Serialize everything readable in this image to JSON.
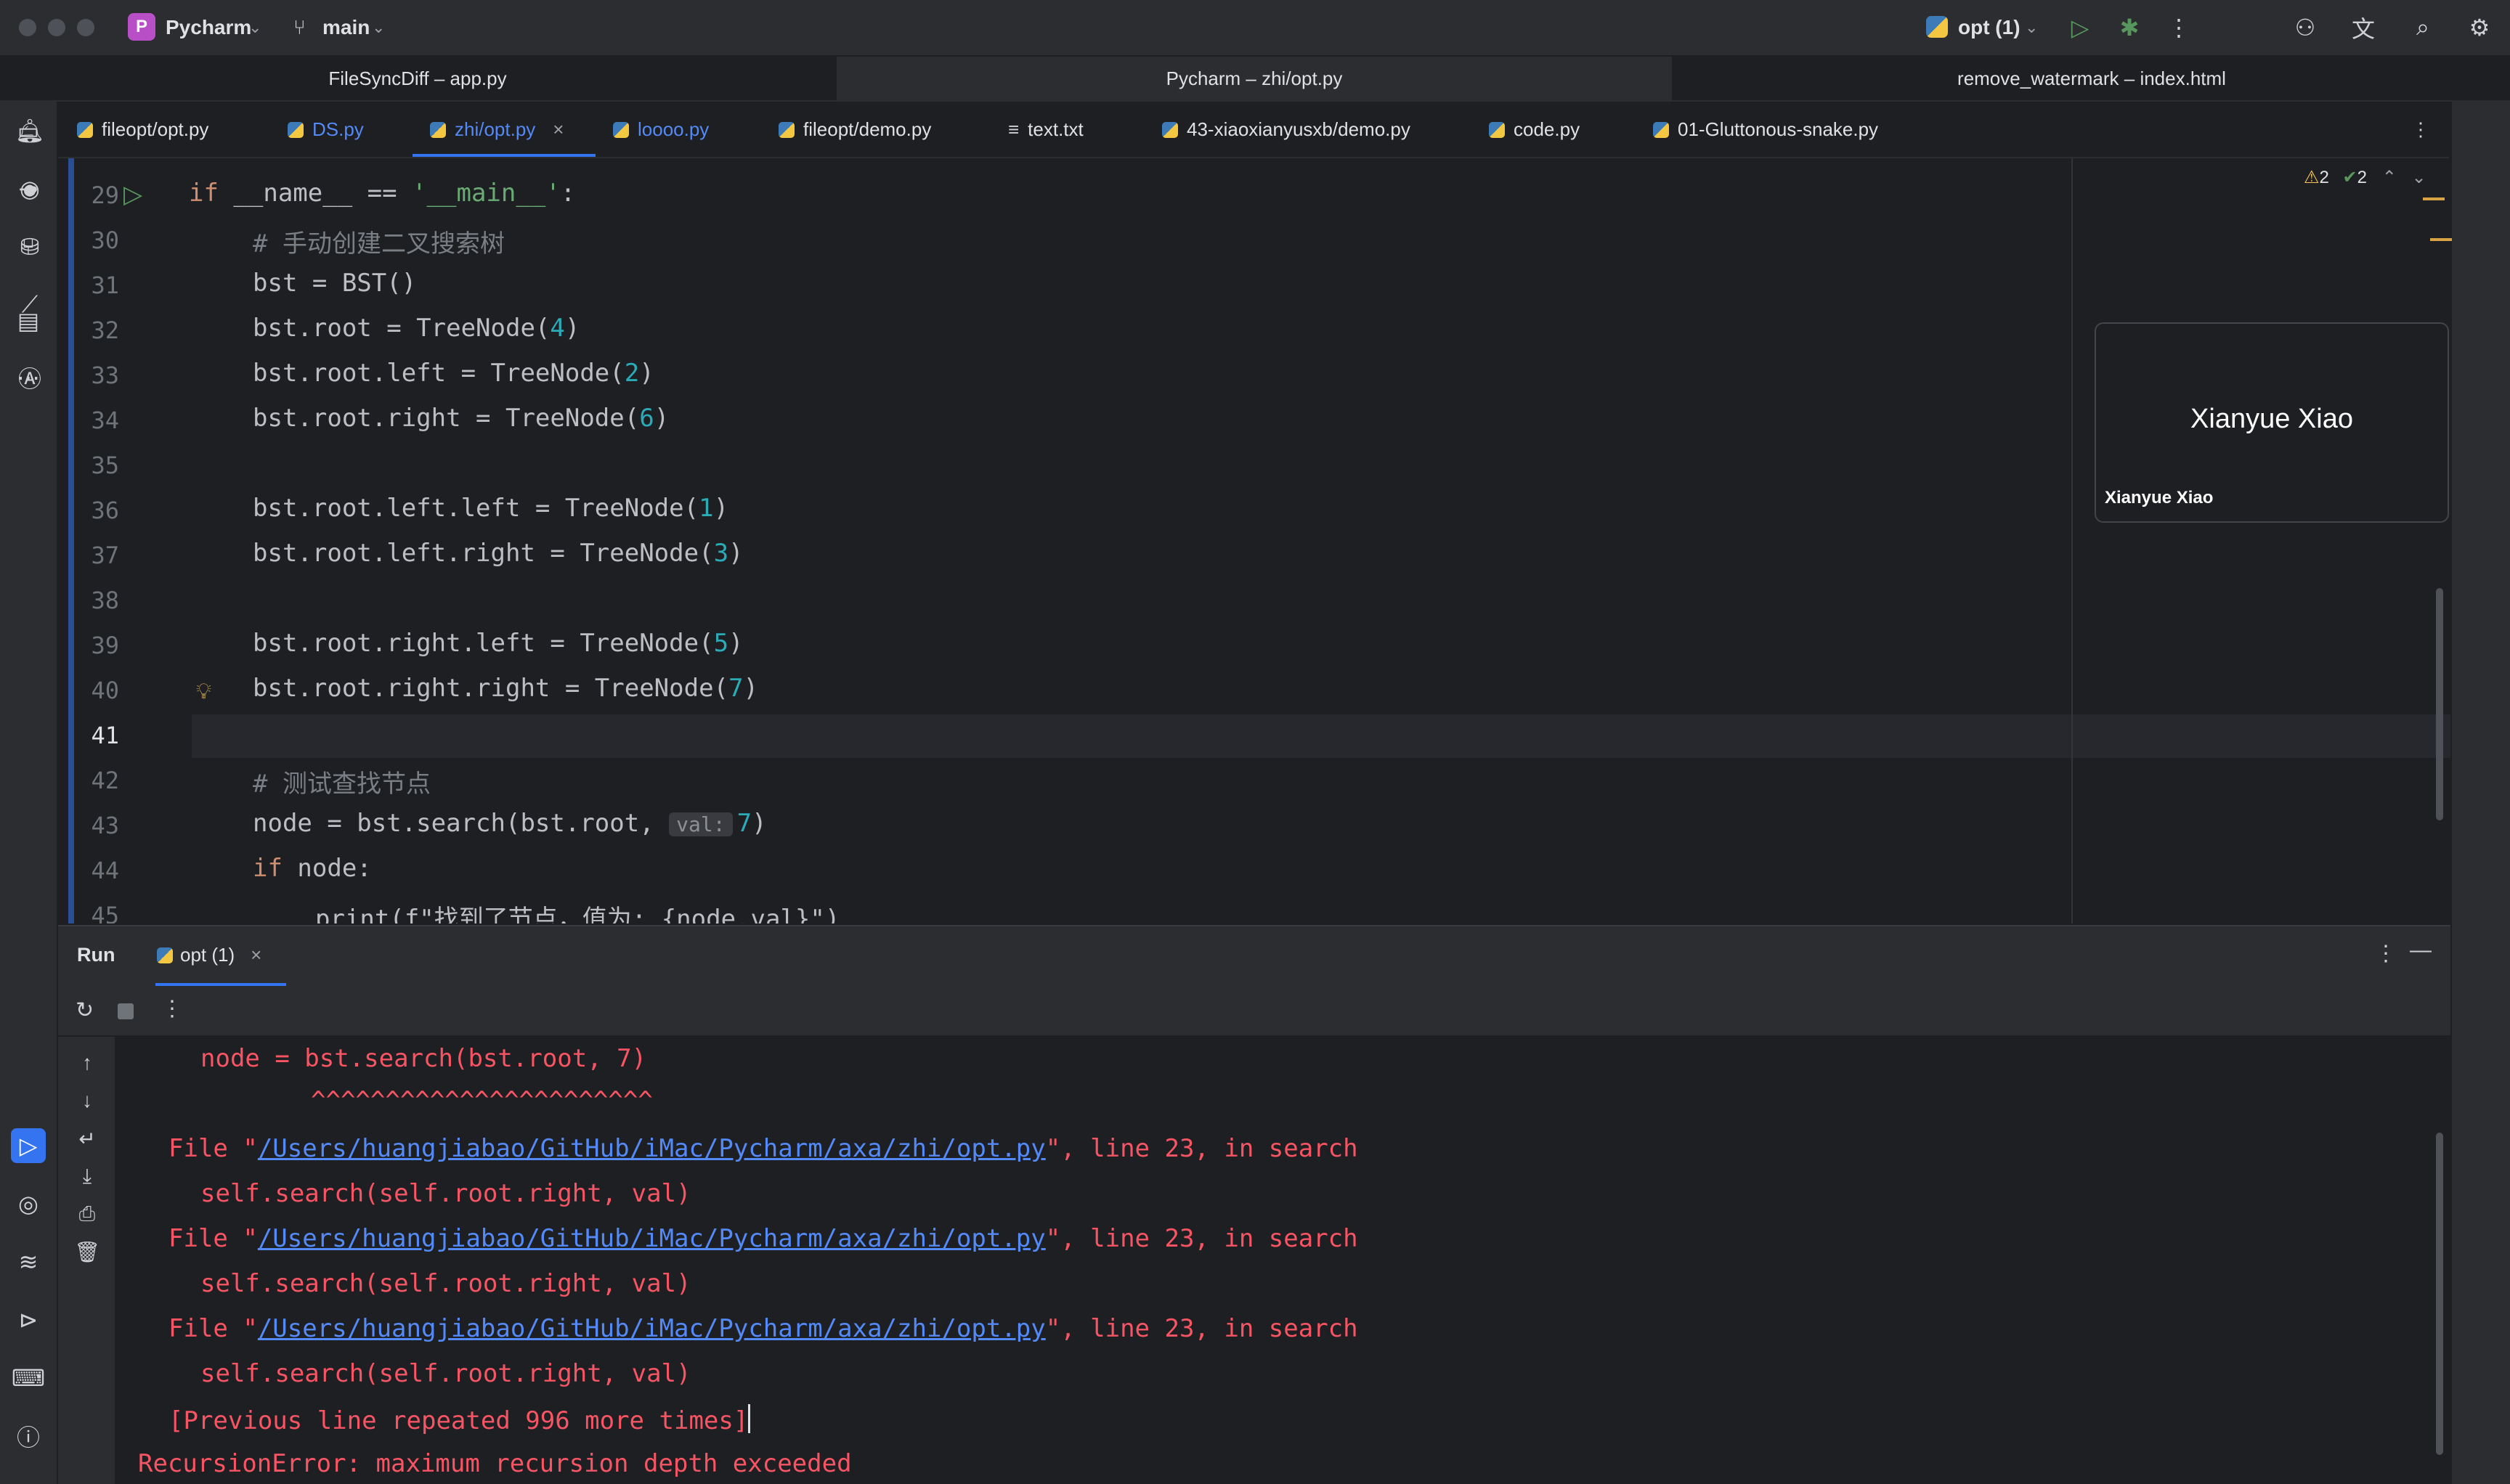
{
  "titlebar": {
    "project_badge": "P",
    "project_name": "Pycharm",
    "branch": "main",
    "run_config": "opt (1)"
  },
  "window_tabs": [
    {
      "label": "FileSyncDiff – app.py"
    },
    {
      "label": "Pycharm – zhi/opt.py"
    },
    {
      "label": "remove_watermark – index.html"
    }
  ],
  "file_tabs": [
    {
      "label": "fileopt/opt.py"
    },
    {
      "label": "DS.py"
    },
    {
      "label": "zhi/opt.py"
    },
    {
      "label": "loooo.py"
    },
    {
      "label": "fileopt/demo.py"
    },
    {
      "label": "text.txt"
    },
    {
      "label": "43-xiaoxianyusxb/demo.py"
    },
    {
      "label": "code.py"
    },
    {
      "label": "01-Gluttonous-snake.py"
    }
  ],
  "inspections": {
    "warnings": "2",
    "ok": "2"
  },
  "editor": {
    "line_numbers": [
      "29",
      "30",
      "31",
      "32",
      "33",
      "34",
      "35",
      "36",
      "37",
      "38",
      "39",
      "40",
      "41",
      "42",
      "43",
      "44",
      "45"
    ],
    "code": {
      "l29_kw": "if",
      "l29_mid": " __name__ == ",
      "l29_str": "'__main__'",
      "l29_end": ":",
      "l30": "# 手动创建二叉搜索树",
      "l31": "bst = BST()",
      "l32_a": "bst.root = TreeNode(",
      "l32_n": "4",
      "l32_b": ")",
      "l33_a": "bst.root.left = TreeNode(",
      "l33_n": "2",
      "l33_b": ")",
      "l34_a": "bst.root.right = TreeNode(",
      "l34_n": "6",
      "l34_b": ")",
      "l36_a": "bst.root.left.left = TreeNode(",
      "l36_n": "1",
      "l36_b": ")",
      "l37_a": "bst.root.left.right = TreeNode(",
      "l37_n": "3",
      "l37_b": ")",
      "l39_a": "bst.root.right.left = TreeNode(",
      "l39_n": "5",
      "l39_b": ")",
      "l40_a": "bst.root.right.right = TreeNode(",
      "l40_n": "7",
      "l40_b": ")",
      "l42": "# 测试查找节点",
      "l43_a": "node = bst.search(bst.root, ",
      "l43_hint": "val:",
      "l43_n": "7",
      "l43_b": ")",
      "l44_kw": "if",
      "l44_b": " node:",
      "l45_a": "print(f\"找到了节点，值为: {node.val}\")"
    }
  },
  "popup": {
    "title": "Xianyue Xiao",
    "caption": "Xianyue Xiao"
  },
  "run_panel": {
    "title": "Run",
    "tab_label": "opt (1)",
    "console": {
      "line1": "node = bst.search(bst.root, 7)",
      "line2": "^^^^^^^^^^^^^^^^^^^^^^^",
      "file_prefix": "File \"",
      "file_path": "/Users/huangjiabao/GitHub/iMac/Pycharm/axa/zhi/opt.py",
      "file_suffix": "\", line 23, in search",
      "call_line": "self.search(self.root.right, val)",
      "repeated": "[Previous line repeated 996 more times]",
      "error": "RecursionError: maximum recursion depth exceeded"
    }
  },
  "colors": {
    "accent": "#3574f0",
    "error": "#f75464",
    "link": "#548af7",
    "keyword": "#cf8e6d",
    "string": "#6aab73",
    "number": "#2aacb8"
  }
}
